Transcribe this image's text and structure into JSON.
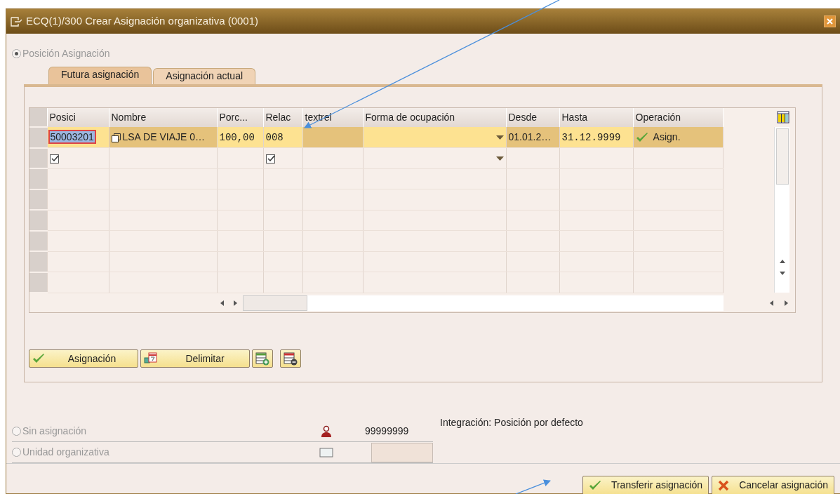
{
  "window": {
    "title": "ECQ(1)/300 Crear Asignación organizativa (0001)"
  },
  "options": [
    {
      "label": "Posición Asignación",
      "selected": true,
      "disabled": true
    },
    {
      "label": "Sin asignación",
      "selected": false,
      "disabled": true
    },
    {
      "label": "Unidad organizativa",
      "selected": false,
      "disabled": true
    }
  ],
  "tabs": [
    {
      "label": "Futura asignación",
      "selected": true
    },
    {
      "label": "Asignación actual",
      "selected": false
    }
  ],
  "table": {
    "columns": [
      "Posici",
      "Nombre",
      "Porc...",
      "Relac",
      "textrel",
      "Forma de ocupación",
      "Desde",
      "Hasta",
      "Operación"
    ],
    "rows": [
      {
        "cells": [
          {
            "kind": "input",
            "text": "50003201",
            "editable": true
          },
          {
            "kind": "text",
            "text": "LSA DE VIAJE 0…",
            "editable": false
          },
          {
            "kind": "number",
            "text": "100,00",
            "editable": true
          },
          {
            "kind": "number",
            "text": "008",
            "editable": true
          },
          {
            "kind": "empty",
            "editable": false
          },
          {
            "kind": "dropdown",
            "editable": true
          },
          {
            "kind": "text",
            "text": "01.01.2…",
            "editable": false
          },
          {
            "kind": "number",
            "text": "31.12.9999",
            "editable": true
          },
          {
            "kind": "status",
            "text": "Asign.",
            "editable": false
          }
        ]
      },
      {
        "cells": [
          {
            "kind": "checkbox",
            "checked": true
          },
          {
            "kind": "empty"
          },
          {
            "kind": "empty"
          },
          {
            "kind": "checkbox",
            "checked": true
          },
          {
            "kind": "empty"
          },
          {
            "kind": "dropdown"
          },
          {
            "kind": "empty"
          },
          {
            "kind": "empty"
          },
          {
            "kind": "empty"
          }
        ]
      }
    ]
  },
  "panel_buttons": [
    {
      "kind": "check",
      "label": "Asignación"
    },
    {
      "kind": "calendar",
      "label": "Delimitar"
    },
    {
      "kind": "add-row"
    },
    {
      "kind": "delete-row"
    }
  ],
  "default_position": {
    "number": "99999999",
    "description": "Integración: Posición por defecto"
  },
  "footer_buttons": [
    {
      "kind": "check",
      "label": "Transferir asignación"
    },
    {
      "kind": "cancel",
      "label": "Cancelar asignación"
    }
  ]
}
